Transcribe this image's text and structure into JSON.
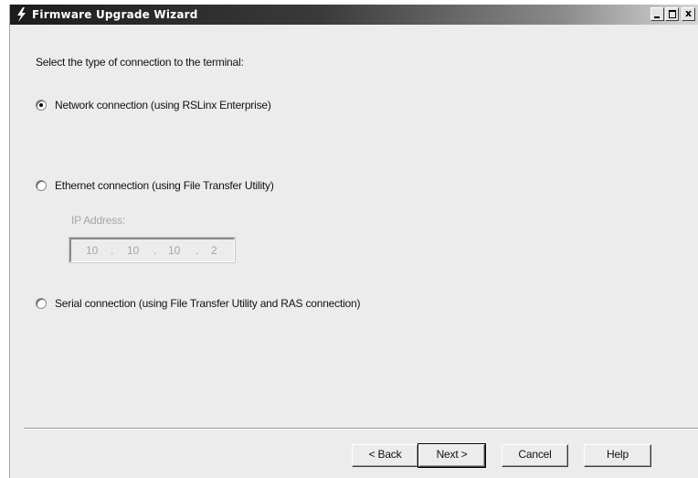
{
  "window": {
    "title": "Firmware Upgrade Wizard",
    "icon": "lightning-icon",
    "caption_buttons": {
      "minimize": "_",
      "maximize": "□",
      "close": "x"
    }
  },
  "prompt": "Select the type of connection to the terminal:",
  "options": [
    {
      "label": "Network connection (using RSLinx Enterprise)",
      "selected": true
    },
    {
      "label": "Ethernet connection (using File Transfer Utility)",
      "selected": false
    },
    {
      "label": "Serial connection (using File Transfer Utility and RAS connection)",
      "selected": false
    }
  ],
  "ip": {
    "label": "IP Address:",
    "octets": [
      "10",
      "10",
      "10",
      "2"
    ],
    "separator": ".",
    "enabled": false
  },
  "buttons": {
    "back": "< Back",
    "next": "Next >",
    "cancel": "Cancel",
    "help": "Help"
  }
}
